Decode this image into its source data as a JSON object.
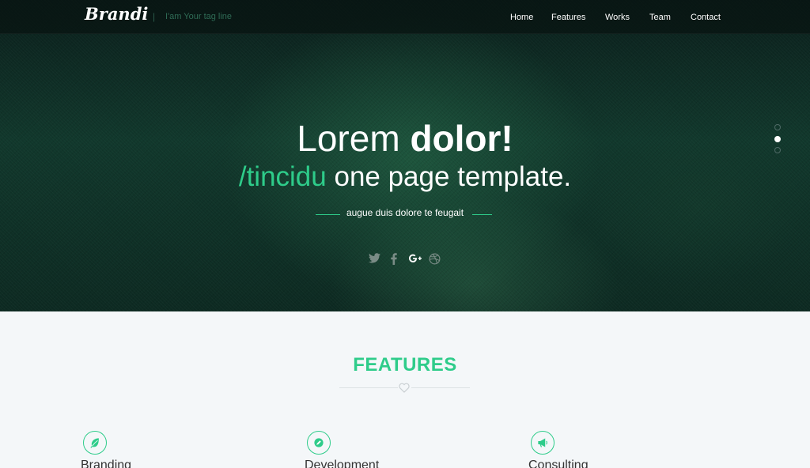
{
  "brand": {
    "logo": "Brandi",
    "separator": "|",
    "tagline": "I'am Your tag line"
  },
  "nav": {
    "items": [
      "Home",
      "Features",
      "Works",
      "Team",
      "Contact"
    ]
  },
  "hero": {
    "title_light": "Lorem ",
    "title_bold": "dolor!",
    "subtitle_accent": "/tincidu",
    "subtitle_rest": " one page template.",
    "caption": "augue duis dolore te feugait",
    "socials": [
      "twitter-icon",
      "facebook-icon",
      "google-plus-icon",
      "dribbble-icon"
    ],
    "slides": 3,
    "active_slide": 2
  },
  "features": {
    "title": "FEATURES",
    "items": [
      {
        "title": "Branding",
        "icon": "leaf-icon"
      },
      {
        "title": "Development",
        "icon": "pencil-icon"
      },
      {
        "title": "Consulting",
        "icon": "megaphone-icon"
      }
    ]
  },
  "colors": {
    "accent": "#2ecc8a",
    "hero_dark": "#0d2a22",
    "nav_bg": "#081412",
    "text_dark": "#333333",
    "page_bg": "#f4f7f9"
  }
}
